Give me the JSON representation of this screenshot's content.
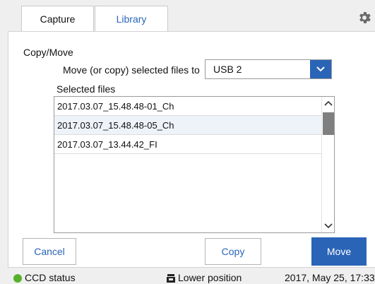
{
  "tabs": [
    {
      "label": "Capture",
      "active": false
    },
    {
      "label": "Library",
      "active": true
    }
  ],
  "settings_icon": "gear-icon",
  "copy_move": {
    "section_title": "Copy/Move",
    "destination_label": "Move (or copy) selected files to",
    "destination_value": "USB 2",
    "selected_files_label": "Selected files",
    "files": [
      "2017.03.07_15.48.48-01_Ch",
      "2017.03.07_15.48.48-05_Ch",
      "2017.03.07_13.44.42_FI"
    ]
  },
  "buttons": {
    "cancel": "Cancel",
    "copy": "Copy",
    "move": "Move"
  },
  "status_bar": {
    "ccd_status": "CCD status",
    "position": "Lower position",
    "datetime": "2017, May 25, 17:33"
  },
  "colors": {
    "accent": "#2a64b6",
    "status_ok": "#55b12a"
  }
}
